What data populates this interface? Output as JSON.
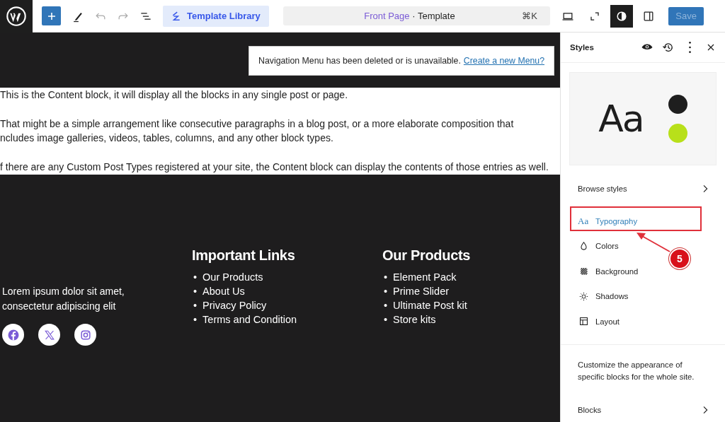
{
  "toolbar": {
    "template_button": "Template Library",
    "command_bar": {
      "page": "Front Page",
      "separator": "·",
      "type": "Template",
      "shortcut": "⌘K"
    },
    "style_toggle_on": true,
    "save": {
      "label": "Save",
      "disabled": true
    }
  },
  "canvas": {
    "notice": {
      "text": "Navigation Menu has been deleted or is unavailable.",
      "link": "Create a new Menu?"
    },
    "paragraphs": [
      "This is the Content block, it will display all the blocks in any single post or page.",
      "That might be a simple arrangement like consecutive paragraphs in a blog post, or a more elaborate composition that\nncludes image galleries, videos, tables, columns, and any other block types.",
      "f there are any Custom Post Types registered at your site, the Content block can display the contents of those entries as well."
    ],
    "footer": {
      "about": "Lorem ipsum dolor sit amet,\nconsectetur adipiscing elit",
      "social": [
        {
          "kind": "facebook"
        },
        {
          "kind": "x"
        },
        {
          "kind": "instagram"
        }
      ],
      "columns": [
        {
          "heading": "Important Links",
          "marker": "•",
          "links": [
            "Our Products",
            "About Us",
            "Privacy Policy",
            "Terms and Condition"
          ]
        },
        {
          "heading": "Our Products",
          "marker": "•",
          "links": [
            "Element Pack",
            "Prime Slider",
            "Ultimate Post kit",
            "Store kits"
          ]
        }
      ]
    }
  },
  "sidebar": {
    "title": "Styles",
    "preview": {
      "sample": "Aa"
    },
    "browse": "Browse styles",
    "items": [
      {
        "kind": "typography",
        "icon": "Aa",
        "label": "Typography",
        "selected": true
      },
      {
        "kind": "colors",
        "label": "Colors",
        "selected": false
      },
      {
        "kind": "background",
        "label": "Background",
        "selected": false
      },
      {
        "kind": "shadows",
        "label": "Shadows",
        "selected": false
      },
      {
        "kind": "layout",
        "label": "Layout",
        "selected": false
      }
    ],
    "description": "Customize the appearance of specific blocks for the whole site.",
    "blocks": "Blocks"
  },
  "annotation": {
    "number": "5"
  }
}
